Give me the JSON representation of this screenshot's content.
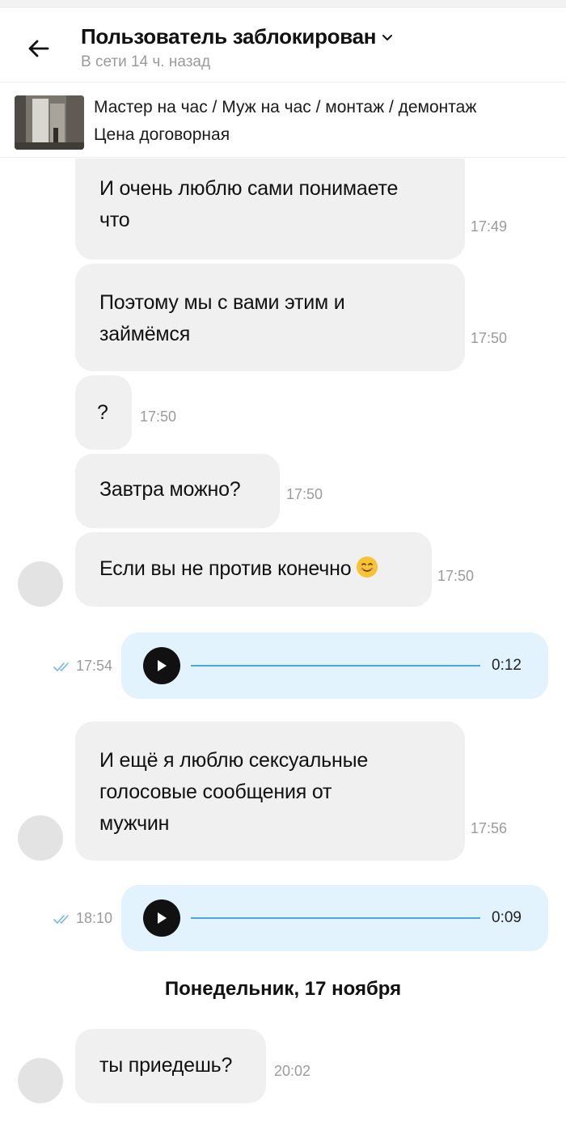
{
  "header": {
    "title": "Пользователь заблокирован",
    "status": "В сети 14 ч. назад",
    "back_icon": "arrow-left-icon",
    "menu_icon": "chevron-down-icon"
  },
  "listing": {
    "title": "Мастер на час / Муж на час / монтаж / демонтаж",
    "price": "Цена договорная"
  },
  "messages": [
    {
      "dir": "in",
      "lines": [
        "И очень люблю сами понимаете",
        "что"
      ],
      "time": "17:49"
    },
    {
      "dir": "in",
      "lines": [
        "Поэтому мы с вами этим и",
        "займёмся"
      ],
      "time": "17:50"
    },
    {
      "dir": "in",
      "text": "?",
      "time": "17:50"
    },
    {
      "dir": "in",
      "text": "Завтра можно?",
      "time": "17:50"
    },
    {
      "dir": "in",
      "text": "Если вы не против конечно",
      "emoji": "smiling-face-emoji",
      "time": "17:50"
    },
    {
      "dir": "out",
      "type": "voice",
      "time": "17:54",
      "duration": "0:12",
      "read": true
    },
    {
      "dir": "in",
      "lines": [
        "И ещё я люблю сексуальные",
        "голосовые сообщения от",
        "мужчин"
      ],
      "time": "17:56"
    },
    {
      "dir": "out",
      "type": "voice",
      "time": "18:10",
      "duration": "0:09",
      "read": true
    },
    {
      "dir": "sep",
      "text": "Понедельник, 17 ноября"
    },
    {
      "dir": "in",
      "text": "ты приедешь?",
      "time": "20:02"
    }
  ],
  "colors": {
    "incoming_bubble": "#f0f0f0",
    "outgoing_bubble": "#e2f3fd",
    "accent": "#4aa7e2",
    "muted_text": "#9b9b9b"
  }
}
